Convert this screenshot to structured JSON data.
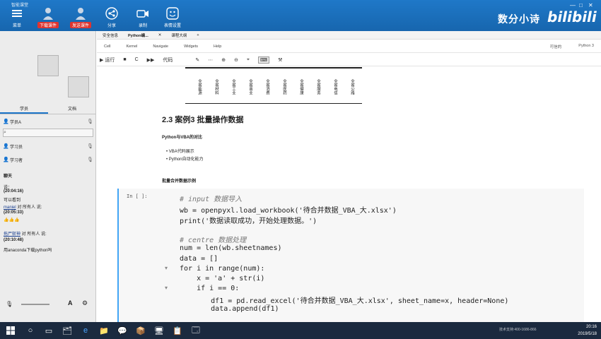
{
  "app": {
    "title": "智能课堂",
    "window_controls": [
      "—",
      "□",
      "✕"
    ]
  },
  "toolbar_top": {
    "buttons": [
      {
        "label": "菜单"
      },
      {
        "label": "下载课件"
      },
      {
        "label": "发送课件"
      },
      {
        "label": "分享"
      },
      {
        "label": "录制"
      },
      {
        "label": "表情设置"
      }
    ],
    "brand": "数分小诗",
    "bilibili": "bilibili"
  },
  "left_panel": {
    "tabs": [
      "学员",
      "文档"
    ],
    "contacts": [
      {
        "name": "学员A"
      },
      {
        "name": "学习员"
      },
      {
        "name": "学习者"
      }
    ],
    "chat": [
      {
        "label": "聊天"
      },
      {
        "line": "说："
      },
      {
        "time": "(20:04:16)"
      },
      {
        "line": "可以看到"
      },
      {
        "name": "maniel",
        "text": " 对 所有人 说:"
      },
      {
        "time": "(20:05:33)"
      },
      {
        "line": "👍👍👍"
      },
      {
        "name": "拖尸斩神",
        "text": " 对 所有人 说:"
      },
      {
        "time": "(20:10:48)"
      },
      {
        "line": "用anaconda下载python吗"
      }
    ]
  },
  "notebook": {
    "tabs": [
      "安全信息",
      "Python编...",
      "✕",
      "课程大纲",
      "+"
    ],
    "menu": [
      "Cell",
      "Kernel",
      "Navigate",
      "Widgets",
      "Help"
    ],
    "menu_right": [
      "可信的",
      "Python 3"
    ],
    "toolbar": [
      "▶ 运行",
      "■",
      "C",
      "▶▶",
      "代码"
    ],
    "table_headers": [
      "全省能源",
      "全省材料",
      "全省工业",
      "全省商业",
      "全省消费",
      "全省医药",
      "全省健康",
      "全省服务",
      "全省电信",
      "全省公路"
    ],
    "section_title": "2.3  案例3 批量操作数据",
    "compare_title": "Python与VBA的对比",
    "bullets": [
      "VBA代码展示",
      "Python自动化能力"
    ],
    "demo_title": "批量合并数据示例",
    "cell_prompt": "In [ ]:",
    "code_lines": [
      "# input 数据导入",
      "wb = openpyxl.load_workbook('待合并数据_VBA_大.xlsx')",
      "print('数据读取成功，开始处理数据。')",
      "",
      "# centre 数据处理",
      "num = len(wb.sheetnames)",
      "data = []",
      "for i in range(num):",
      "    x = 'a' + str(i)",
      "    if i == 0:",
      "        df1 = pd.read_excel('待合并数据_VBA_大.xlsx', sheet_name=x, header=None)",
      "        data.append(df1)"
    ]
  },
  "taskbar": {
    "time": "20:16",
    "date": "2019/5/18",
    "tray_text": "技术支持:400-1686-866"
  }
}
